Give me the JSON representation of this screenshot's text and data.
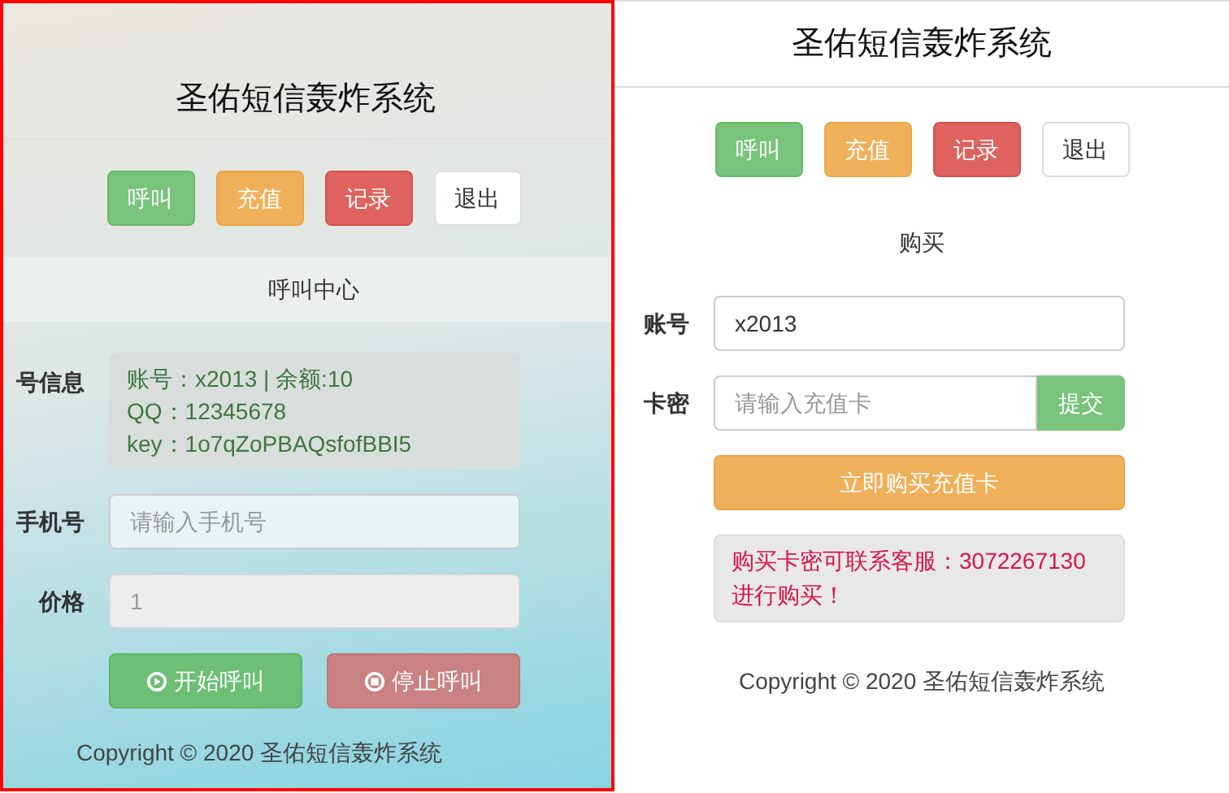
{
  "left_panel": {
    "title": "圣佑短信轰炸系统",
    "nav": [
      {
        "label": "呼叫",
        "kind": "success"
      },
      {
        "label": "充值",
        "kind": "warning"
      },
      {
        "label": "记录",
        "kind": "danger"
      },
      {
        "label": "退出",
        "kind": "default"
      }
    ],
    "section": "呼叫中心",
    "account_info": {
      "label": "号信息",
      "lines": [
        "账号：x2013 | 余额:10",
        "QQ：12345678",
        "key：1o7qZoPBAQsfofBBI5"
      ]
    },
    "fields": [
      {
        "label": "手机号",
        "placeholder": "请输入手机号",
        "disabled": false
      },
      {
        "label": "价格",
        "value": "1",
        "disabled": true
      }
    ],
    "actions": [
      {
        "label": "开始呼叫",
        "kind": "start"
      },
      {
        "label": "停止呼叫",
        "kind": "stop"
      }
    ],
    "footer": "Copyright © 2020 圣佑短信轰炸系统"
  },
  "right_panel": {
    "title": "圣佑短信轰炸系统",
    "nav": [
      {
        "label": "呼叫",
        "kind": "success"
      },
      {
        "label": "充值",
        "kind": "warning"
      },
      {
        "label": "记录",
        "kind": "danger"
      },
      {
        "label": "退出",
        "kind": "default"
      }
    ],
    "section": "购买",
    "account": {
      "label": "账号",
      "value": "x2013"
    },
    "card": {
      "label": "卡密",
      "placeholder": "请输入充值卡",
      "button": "提交"
    },
    "buy_button": "立即购买充值卡",
    "notice": [
      "购买卡密可联系客服：3072267130",
      "进行购买！"
    ],
    "footer": "Copyright © 2020 圣佑短信轰炸系统"
  }
}
